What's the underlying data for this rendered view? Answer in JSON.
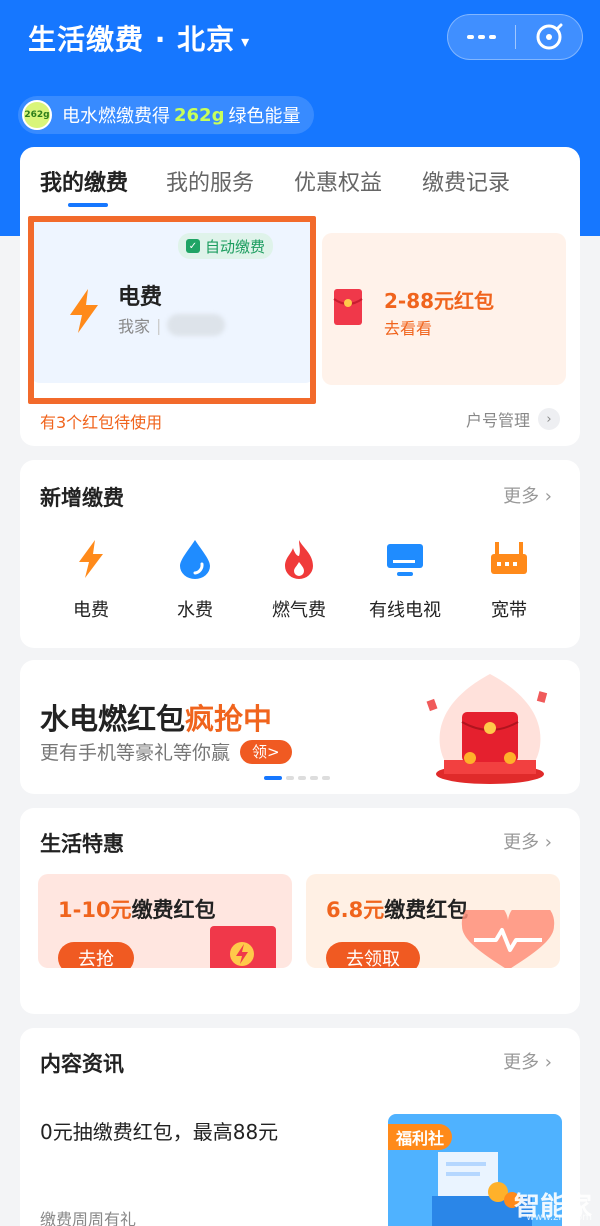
{
  "header": {
    "title": "生活缴费 · 北京",
    "caret": "▾"
  },
  "energy_banner": {
    "badge": "262g",
    "text_before": "电水燃缴费得",
    "amount": "262g",
    "text_after": "绿色能量"
  },
  "my_payments": {
    "tabs": [
      "我的缴费",
      "我的服务",
      "优惠权益",
      "缴费记录"
    ],
    "active_tab": 0,
    "bill": {
      "tag": "自动缴费",
      "name": "电费",
      "account_label": "我家",
      "icon": "lightning-icon"
    },
    "redpacket": {
      "title": "2-88元红包",
      "action": "去看看"
    },
    "pending_text": "有3个红包待使用",
    "manage_label": "户号管理"
  },
  "new_payment": {
    "title": "新增缴费",
    "more": "更多",
    "items": [
      {
        "label": "电费",
        "icon": "lightning-icon"
      },
      {
        "label": "水费",
        "icon": "water-drop-icon"
      },
      {
        "label": "燃气费",
        "icon": "flame-icon"
      },
      {
        "label": "有线电视",
        "icon": "tv-icon"
      },
      {
        "label": "宽带",
        "icon": "router-icon"
      }
    ]
  },
  "promo": {
    "title_main": "水电燃红包",
    "title_hot": "疯抢中",
    "subtitle": "更有手机等豪礼等你赢",
    "button": "领>",
    "pages": 5,
    "current_page": 0
  },
  "life_deals": {
    "title": "生活特惠",
    "more": "更多",
    "deals": [
      {
        "amount": "1-10元",
        "text": "缴费红包",
        "button": "去抢"
      },
      {
        "amount": "6.8元",
        "text": "缴费红包",
        "button": "去领取"
      }
    ]
  },
  "content": {
    "title": "内容资讯",
    "more": "更多",
    "news_title": "0元抽缴费红包，最高88元",
    "news_sub": "缴费周周有礼",
    "thumb_tag": "福利社"
  },
  "watermark": {
    "text": "智能家",
    "url": "www.znj.com"
  },
  "colors": {
    "primary": "#1677ff",
    "accent": "#f0641d",
    "highlight_box": "#f26a2b"
  }
}
